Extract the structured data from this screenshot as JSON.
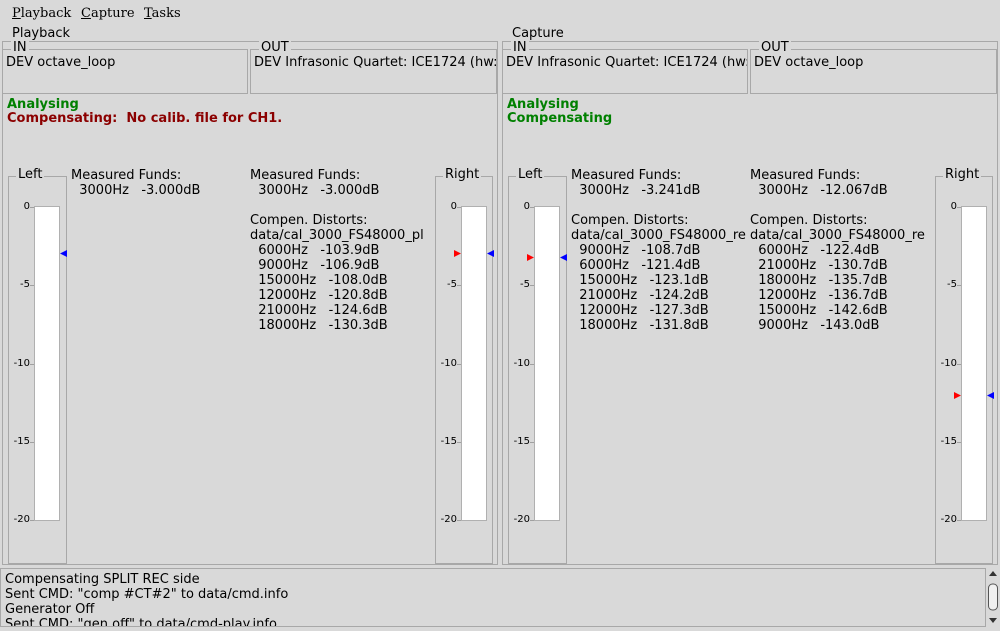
{
  "menu": [
    "Playback",
    "Capture",
    "Tasks"
  ],
  "playback": {
    "title": "Playback",
    "in_label": "IN",
    "in_value": "DEV octave_loop",
    "out_label": "OUT",
    "out_value": "DEV Infrasonic Quartet: ICE1724 (hw:",
    "status1": "Analysing",
    "status2": "Compensating:  No calib. file for CH1.",
    "left_label": "Left",
    "right_label": "Right",
    "left_measured_title": "Measured Funds:",
    "left_measured": "  3000Hz   -3.000dB",
    "right_measured_title": "Measured Funds:",
    "right_measured": "  3000Hz   -3.000dB",
    "left_distorts": "",
    "right_distorts": "Compen. Distorts:\ndata/cal_3000_FS48000_pl\n  6000Hz   -103.9dB\n  9000Hz   -106.9dB\n  15000Hz   -108.0dB\n  12000Hz   -120.8dB\n  21000Hz   -124.6dB\n  18000Hz   -130.3dB"
  },
  "capture": {
    "title": "Capture",
    "in_label": "IN",
    "in_value": "DEV Infrasonic Quartet: ICE1724 (hw:",
    "out_label": "OUT",
    "out_value": "DEV octave_loop",
    "status1": "Analysing",
    "status2": "Compensating",
    "left_label": "Left",
    "right_label": "Right",
    "left_measured_title": "Measured Funds:",
    "left_measured": "  3000Hz   -3.241dB",
    "right_measured_title": "Measured Funds:",
    "right_measured": "  3000Hz   -12.067dB",
    "left_distorts": "Compen. Distorts:\ndata/cal_3000_FS48000_re\n  9000Hz   -108.7dB\n  6000Hz   -121.4dB\n  15000Hz   -123.1dB\n  21000Hz   -124.2dB\n  12000Hz   -127.3dB\n  18000Hz   -131.8dB",
    "right_distorts": "Compen. Distorts:\ndata/cal_3000_FS48000_re\n  6000Hz   -122.4dB\n  21000Hz   -130.7dB\n  18000Hz   -135.7dB\n  12000Hz   -136.7dB\n  15000Hz   -142.6dB\n  9000Hz   -143.0dB"
  },
  "meter_ticks": [
    "0",
    "-5",
    "-10",
    "-15",
    "-20"
  ],
  "meter_levels_db": {
    "playback_left": {
      "red": null,
      "blue": -3.0
    },
    "playback_right": {
      "red": -3.0,
      "blue": -3.0
    },
    "capture_left": {
      "red": -3.241,
      "blue": -3.241
    },
    "capture_right": {
      "red": -12.067,
      "blue": -12.067
    }
  },
  "log_text": "Compensating SPLIT REC side\nSent CMD: \"comp #CT#2\" to data/cmd.info\nGenerator Off\nSent CMD: \"gen off\" to data/cmd-play.info",
  "colors": {
    "status_ok": "#008000",
    "status_err": "#8b0000",
    "marker_red": "#ff0000",
    "marker_blue": "#0000ff"
  }
}
